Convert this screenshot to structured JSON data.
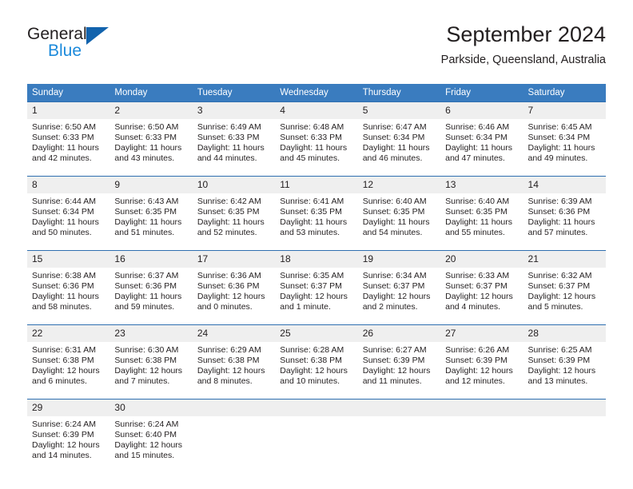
{
  "brand": {
    "name_part1": "General",
    "name_part2": "Blue",
    "logo_icon": "triangle-icon"
  },
  "header": {
    "title": "September 2024",
    "subtitle": "Parkside, Queensland, Australia"
  },
  "colors": {
    "header_blue": "#3a7cbf",
    "cell_border_blue": "#2f6fb0",
    "daynum_background": "#efefef",
    "brand_blue": "#1c8adb",
    "logo_blue": "#1263ad",
    "text": "#231f20"
  },
  "weekday_headers": [
    "Sunday",
    "Monday",
    "Tuesday",
    "Wednesday",
    "Thursday",
    "Friday",
    "Saturday"
  ],
  "weeks": [
    [
      {
        "day": "1",
        "sunrise": "Sunrise: 6:50 AM",
        "sunset": "Sunset: 6:33 PM",
        "daylight": "Daylight: 11 hours and 42 minutes."
      },
      {
        "day": "2",
        "sunrise": "Sunrise: 6:50 AM",
        "sunset": "Sunset: 6:33 PM",
        "daylight": "Daylight: 11 hours and 43 minutes."
      },
      {
        "day": "3",
        "sunrise": "Sunrise: 6:49 AM",
        "sunset": "Sunset: 6:33 PM",
        "daylight": "Daylight: 11 hours and 44 minutes."
      },
      {
        "day": "4",
        "sunrise": "Sunrise: 6:48 AM",
        "sunset": "Sunset: 6:33 PM",
        "daylight": "Daylight: 11 hours and 45 minutes."
      },
      {
        "day": "5",
        "sunrise": "Sunrise: 6:47 AM",
        "sunset": "Sunset: 6:34 PM",
        "daylight": "Daylight: 11 hours and 46 minutes."
      },
      {
        "day": "6",
        "sunrise": "Sunrise: 6:46 AM",
        "sunset": "Sunset: 6:34 PM",
        "daylight": "Daylight: 11 hours and 47 minutes."
      },
      {
        "day": "7",
        "sunrise": "Sunrise: 6:45 AM",
        "sunset": "Sunset: 6:34 PM",
        "daylight": "Daylight: 11 hours and 49 minutes."
      }
    ],
    [
      {
        "day": "8",
        "sunrise": "Sunrise: 6:44 AM",
        "sunset": "Sunset: 6:34 PM",
        "daylight": "Daylight: 11 hours and 50 minutes."
      },
      {
        "day": "9",
        "sunrise": "Sunrise: 6:43 AM",
        "sunset": "Sunset: 6:35 PM",
        "daylight": "Daylight: 11 hours and 51 minutes."
      },
      {
        "day": "10",
        "sunrise": "Sunrise: 6:42 AM",
        "sunset": "Sunset: 6:35 PM",
        "daylight": "Daylight: 11 hours and 52 minutes."
      },
      {
        "day": "11",
        "sunrise": "Sunrise: 6:41 AM",
        "sunset": "Sunset: 6:35 PM",
        "daylight": "Daylight: 11 hours and 53 minutes."
      },
      {
        "day": "12",
        "sunrise": "Sunrise: 6:40 AM",
        "sunset": "Sunset: 6:35 PM",
        "daylight": "Daylight: 11 hours and 54 minutes."
      },
      {
        "day": "13",
        "sunrise": "Sunrise: 6:40 AM",
        "sunset": "Sunset: 6:35 PM",
        "daylight": "Daylight: 11 hours and 55 minutes."
      },
      {
        "day": "14",
        "sunrise": "Sunrise: 6:39 AM",
        "sunset": "Sunset: 6:36 PM",
        "daylight": "Daylight: 11 hours and 57 minutes."
      }
    ],
    [
      {
        "day": "15",
        "sunrise": "Sunrise: 6:38 AM",
        "sunset": "Sunset: 6:36 PM",
        "daylight": "Daylight: 11 hours and 58 minutes."
      },
      {
        "day": "16",
        "sunrise": "Sunrise: 6:37 AM",
        "sunset": "Sunset: 6:36 PM",
        "daylight": "Daylight: 11 hours and 59 minutes."
      },
      {
        "day": "17",
        "sunrise": "Sunrise: 6:36 AM",
        "sunset": "Sunset: 6:36 PM",
        "daylight": "Daylight: 12 hours and 0 minutes."
      },
      {
        "day": "18",
        "sunrise": "Sunrise: 6:35 AM",
        "sunset": "Sunset: 6:37 PM",
        "daylight": "Daylight: 12 hours and 1 minute."
      },
      {
        "day": "19",
        "sunrise": "Sunrise: 6:34 AM",
        "sunset": "Sunset: 6:37 PM",
        "daylight": "Daylight: 12 hours and 2 minutes."
      },
      {
        "day": "20",
        "sunrise": "Sunrise: 6:33 AM",
        "sunset": "Sunset: 6:37 PM",
        "daylight": "Daylight: 12 hours and 4 minutes."
      },
      {
        "day": "21",
        "sunrise": "Sunrise: 6:32 AM",
        "sunset": "Sunset: 6:37 PM",
        "daylight": "Daylight: 12 hours and 5 minutes."
      }
    ],
    [
      {
        "day": "22",
        "sunrise": "Sunrise: 6:31 AM",
        "sunset": "Sunset: 6:38 PM",
        "daylight": "Daylight: 12 hours and 6 minutes."
      },
      {
        "day": "23",
        "sunrise": "Sunrise: 6:30 AM",
        "sunset": "Sunset: 6:38 PM",
        "daylight": "Daylight: 12 hours and 7 minutes."
      },
      {
        "day": "24",
        "sunrise": "Sunrise: 6:29 AM",
        "sunset": "Sunset: 6:38 PM",
        "daylight": "Daylight: 12 hours and 8 minutes."
      },
      {
        "day": "25",
        "sunrise": "Sunrise: 6:28 AM",
        "sunset": "Sunset: 6:38 PM",
        "daylight": "Daylight: 12 hours and 10 minutes."
      },
      {
        "day": "26",
        "sunrise": "Sunrise: 6:27 AM",
        "sunset": "Sunset: 6:39 PM",
        "daylight": "Daylight: 12 hours and 11 minutes."
      },
      {
        "day": "27",
        "sunrise": "Sunrise: 6:26 AM",
        "sunset": "Sunset: 6:39 PM",
        "daylight": "Daylight: 12 hours and 12 minutes."
      },
      {
        "day": "28",
        "sunrise": "Sunrise: 6:25 AM",
        "sunset": "Sunset: 6:39 PM",
        "daylight": "Daylight: 12 hours and 13 minutes."
      }
    ],
    [
      {
        "day": "29",
        "sunrise": "Sunrise: 6:24 AM",
        "sunset": "Sunset: 6:39 PM",
        "daylight": "Daylight: 12 hours and 14 minutes."
      },
      {
        "day": "30",
        "sunrise": "Sunrise: 6:24 AM",
        "sunset": "Sunset: 6:40 PM",
        "daylight": "Daylight: 12 hours and 15 minutes."
      },
      {
        "day": "",
        "sunrise": "",
        "sunset": "",
        "daylight": ""
      },
      {
        "day": "",
        "sunrise": "",
        "sunset": "",
        "daylight": ""
      },
      {
        "day": "",
        "sunrise": "",
        "sunset": "",
        "daylight": ""
      },
      {
        "day": "",
        "sunrise": "",
        "sunset": "",
        "daylight": ""
      },
      {
        "day": "",
        "sunrise": "",
        "sunset": "",
        "daylight": ""
      }
    ]
  ]
}
